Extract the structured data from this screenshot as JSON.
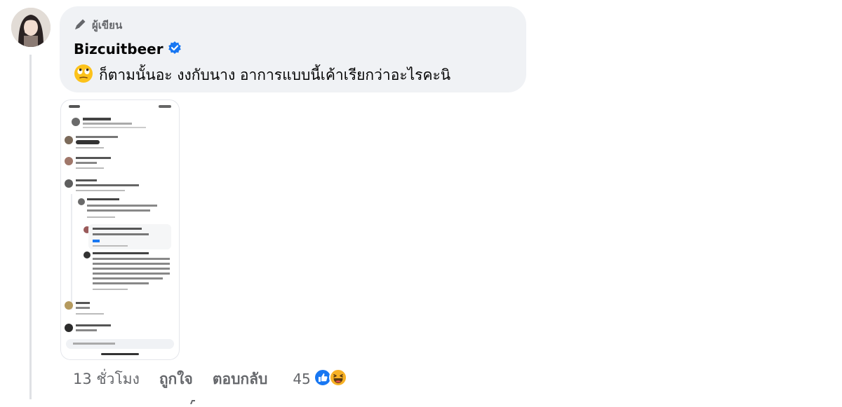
{
  "comment": {
    "badge": {
      "icon": "pencil-icon",
      "label": "ผู้เขียน"
    },
    "author": {
      "name": "Bizcuitbeer",
      "verified_icon": "verified-badge-icon"
    },
    "message": {
      "emoji_icon": "rolling-eyes-emoji-icon",
      "text": "ก็ตามนั้นอะ งงกับนาง อาการแบบนี้เค้าเรียกว่าอะไรคะนิ"
    },
    "attachment": {
      "type": "phone-screenshot-image"
    },
    "footer": {
      "time": "13 ชั่วโมง",
      "like_label": "ถูกใจ",
      "reply_label": "ตอบกลับ",
      "reaction_count": "45",
      "reaction_icons": [
        "like-reaction-icon",
        "haha-reaction-icon"
      ]
    }
  },
  "colors": {
    "bubble": "#f0f2f5",
    "secondary_text": "#65676b",
    "verified": "#1877f2",
    "like": "#1877f2",
    "haha": "#f7b125"
  }
}
